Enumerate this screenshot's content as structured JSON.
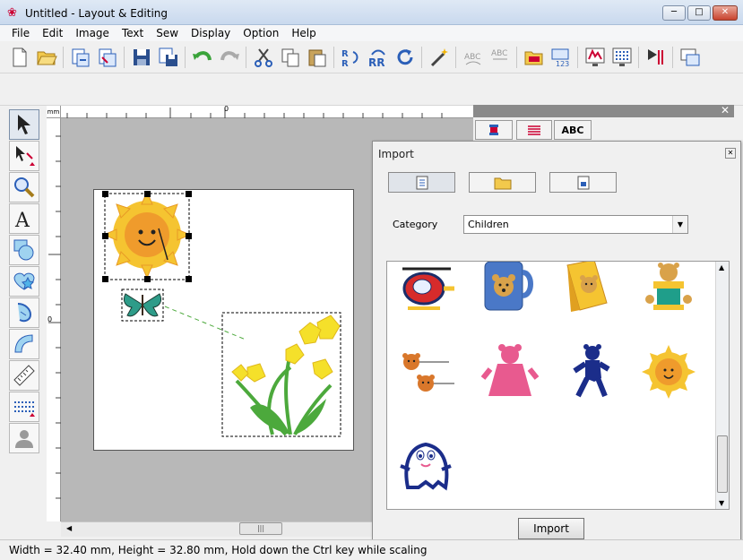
{
  "window": {
    "title": "Untitled - Layout & Editing",
    "minimize": "─",
    "maximize": "□",
    "close": "✕"
  },
  "menu": [
    "File",
    "Edit",
    "Image",
    "Text",
    "Sew",
    "Display",
    "Option",
    "Help"
  ],
  "toolbar_icons": [
    "new-file-icon",
    "open-folder-icon",
    "import-icon",
    "export-icon",
    "save-icon",
    "save-as-icon",
    "undo-icon",
    "redo-icon",
    "cut-icon",
    "copy-icon",
    "paste-icon",
    "mirror-horizontal-icon",
    "mirror-vertical-icon",
    "rotate-icon",
    "magic-wand-icon",
    "text-arrange-icon",
    "text-unarrange-icon",
    "hoop-settings-icon",
    "sewing-order-icon",
    "preview-icon",
    "stitch-simulator-icon",
    "write-to-card-icon",
    "design-property-icon"
  ],
  "left_tools": [
    "select-arrow-icon",
    "point-edit-icon",
    "zoom-icon",
    "text-icon",
    "outline-shapes-icon",
    "stamp-shapes-icon",
    "auto-punch-icon",
    "design-center-icon",
    "measure-icon",
    "stitch-pattern-icon",
    "photo-stitch-icon"
  ],
  "ruler": {
    "unit": "mm",
    "zero": "0"
  },
  "status_text": "Width  = 32.40 mm, Height = 32.80 mm, Hold down the Ctrl key while scaling",
  "right_panel": {
    "tabs": [
      "",
      "",
      "ABC"
    ],
    "close": "✕"
  },
  "import_dialog": {
    "title": "Import",
    "close": "✕",
    "category_label": "Category",
    "category_value": "Children",
    "import_button": "Import",
    "items": [
      "helicopter",
      "bear-mug",
      "bear-book",
      "bear-spool",
      "bear-pins",
      "pink-bear",
      "blue-bear",
      "sun",
      "ghost"
    ]
  },
  "colors": {
    "sun_yellow": "#f5c431",
    "sun_orange": "#ef9b2c",
    "leaf_green": "#4ca93c",
    "accent_blue": "#2b5fb8"
  }
}
